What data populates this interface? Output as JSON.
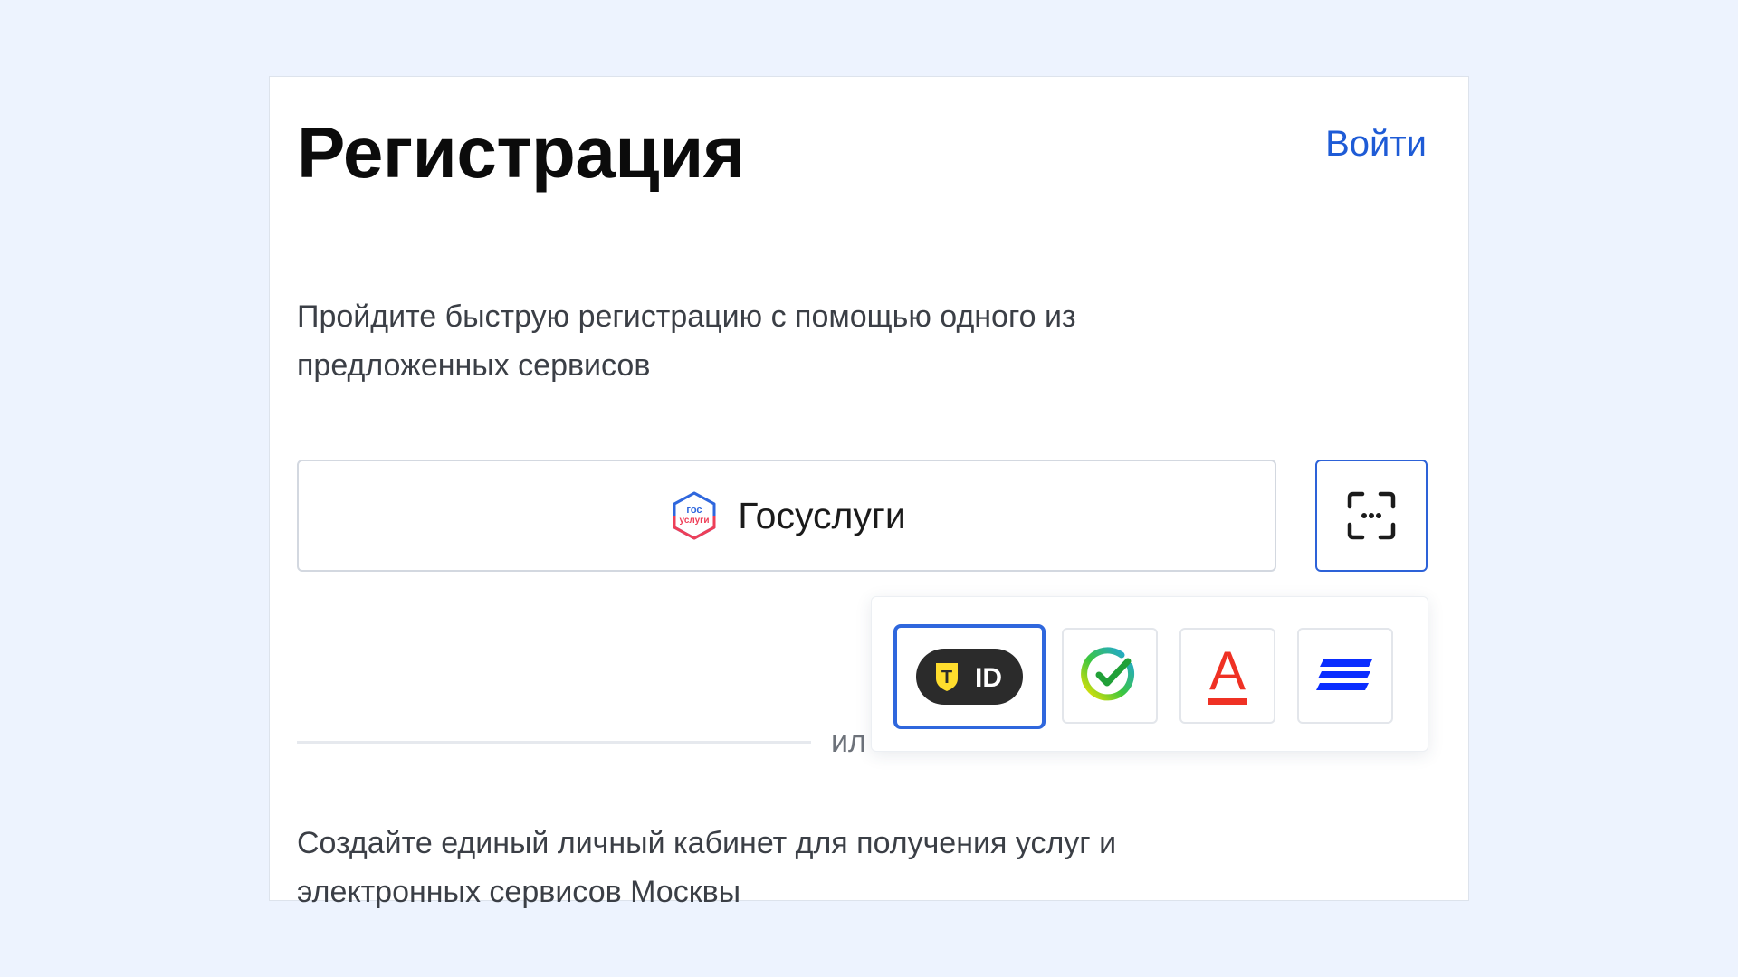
{
  "header": {
    "title": "Регистрация",
    "login_link": "Войти"
  },
  "intro_text": "Пройдите быструю регистрацию с помощью одного из предложенных сервисов",
  "gosuslugi_button": {
    "label": "Госуслуги",
    "icon": "gosuslugi-logo-icon",
    "logo_text_top": "гос",
    "logo_text_bottom": "услуги"
  },
  "qr_button": {
    "icon": "scan-qr-icon"
  },
  "divider": {
    "text": "ил"
  },
  "providers_popup": {
    "options": [
      {
        "name": "T ID",
        "icon": "tinkoff-id-icon",
        "id_text": "ID",
        "badge_text": "T",
        "selected": true
      },
      {
        "name": "Sber ID",
        "icon": "sber-check-icon",
        "selected": false
      },
      {
        "name": "Alfa",
        "icon": "alfa-a-icon",
        "letter": "А",
        "selected": false
      },
      {
        "name": "VTB",
        "icon": "vtb-stripes-icon",
        "selected": false
      }
    ]
  },
  "footer_text": "Создайте единый личный кабинет для получения услуг и электронных сервисов Москвы",
  "colors": {
    "background": "#edf3fe",
    "accent": "#1e5bd6",
    "selected_border": "#2f67dd",
    "alfa_red": "#ef3124",
    "vtb_blue": "#0a2dff",
    "tid_yellow": "#ffdd2d"
  }
}
